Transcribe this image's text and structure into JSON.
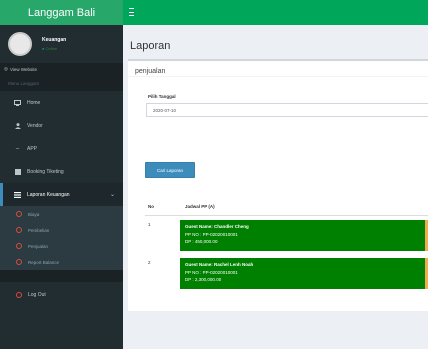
{
  "app": {
    "logo_text": "Langgam Bali"
  },
  "user": {
    "name": "Keuangan",
    "status": "Online"
  },
  "sidebar": {
    "visit_label": "View Website",
    "menu_header": "Menu Langgam",
    "items": [
      {
        "label": "Home"
      },
      {
        "label": "Vendor"
      },
      {
        "label": "APP"
      },
      {
        "label": "Booking Tiketing"
      },
      {
        "label": "Laporan Keuangan"
      }
    ],
    "submenu": [
      {
        "label": "Biaya"
      },
      {
        "label": "Pembelian"
      },
      {
        "label": "Penjualan"
      },
      {
        "label": "Report Balance"
      }
    ],
    "logout_label": "Log Out"
  },
  "page": {
    "title": "Laporan",
    "box_title": "penjualan",
    "date_label": "Pilih Tanggal",
    "date_value": "2020-07-10",
    "button_label": "Cari Laporan",
    "table": {
      "headers": [
        "No",
        "Jadwal PP (A)"
      ],
      "rows": [
        {
          "no": "1",
          "line1": "Guest Name: Chandler Cheng",
          "line2": "PP NO : PP-02020010001",
          "line3": "DP : 450,000.00"
        },
        {
          "no": "2",
          "line1": "Guest Name: Rachel Lenh Noah",
          "line2": "PP NO : PP-02020010001",
          "line3": "DP : 2,300,000.00"
        }
      ]
    }
  },
  "colors": {
    "brand_green": "#00a65a",
    "sidebar_bg": "#222d32",
    "button_blue": "#3c8dbc",
    "row_green": "#008000",
    "accent_orange": "#f0ad4e"
  }
}
